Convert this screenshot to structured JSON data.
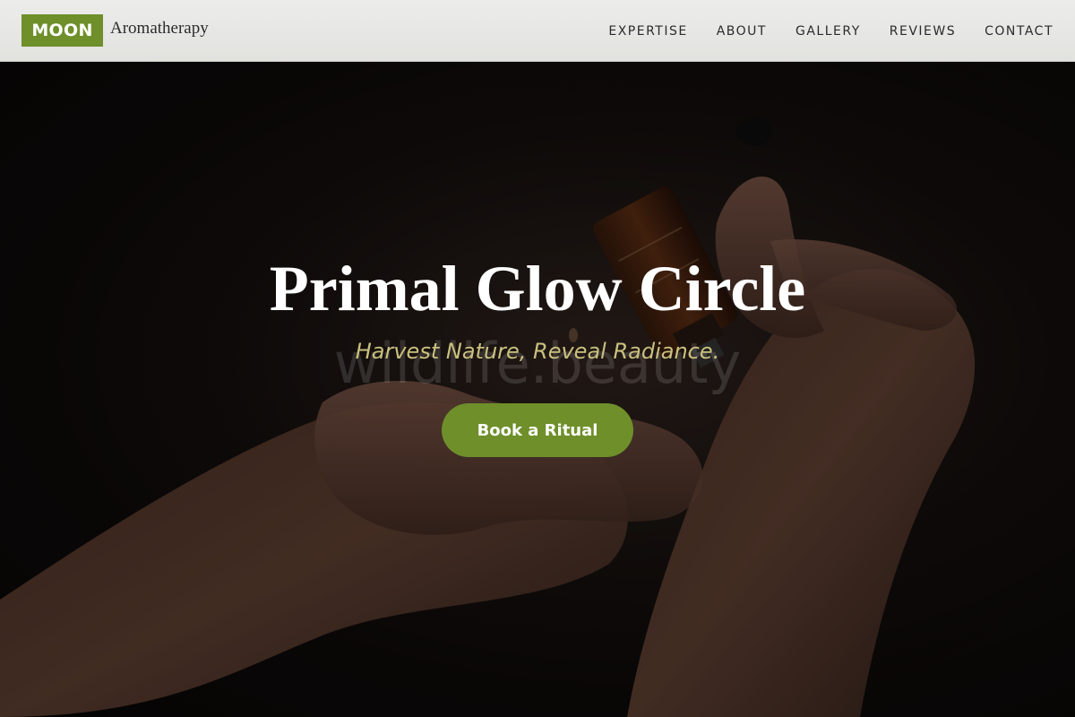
{
  "brand": {
    "badge": "MOON",
    "name": "Aromatherapy",
    "accent_color": "#6e8f2a"
  },
  "nav": {
    "items": [
      {
        "label": "EXPERTISE"
      },
      {
        "label": "ABOUT"
      },
      {
        "label": "GALLERY"
      },
      {
        "label": "REVIEWS"
      },
      {
        "label": "CONTACT"
      }
    ]
  },
  "hero": {
    "title": "Primal Glow Circle",
    "subtitle": "Harvest Nature, Reveal Radiance.",
    "watermark": "wildlife.beauty",
    "cta_label": "Book a Ritual",
    "subtitle_color": "#c9c07e",
    "background_image": "hands-dropping-essential-oil-bottle"
  }
}
